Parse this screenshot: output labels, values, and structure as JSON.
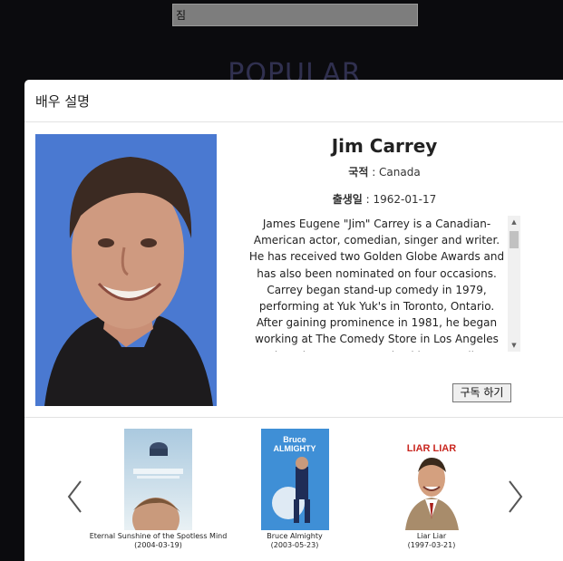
{
  "search": {
    "value": "짐"
  },
  "background": {
    "heading": "POPULAR"
  },
  "modal": {
    "title": "배우 설명",
    "actor": {
      "name": "Jim Carrey",
      "nationality_label": "국적",
      "nationality": "Canada",
      "birthdate_label": "출생일",
      "birthdate": "1962-01-17",
      "bio": "James Eugene \"Jim\" Carrey is a Canadian-American actor, comedian, singer and writer. He has received two Golden Globe Awards and has also been nominated on four occasions. Carrey began stand-up comedy in 1979, performing at Yuk Yuk's in Toronto, Ontario. After gaining prominence in 1981, he began working at The Comedy Store in Los Angeles where he was soon noticed by comedian Rodney Dangerfield, who immediately signed him to open his tour performances."
    },
    "subscribe_label": "구독 하기",
    "movies": [
      {
        "title": "Eternal Sunshine of the Spotless Mind",
        "date": "(2004-03-19)"
      },
      {
        "title": "Bruce Almighty",
        "date": "(2003-05-23)",
        "poster_text_1": "Bruce",
        "poster_text_2": "ALMIGHTY"
      },
      {
        "title": "Liar Liar",
        "date": "(1997-03-21)",
        "poster_text": "LIAR LIAR"
      }
    ]
  },
  "icons": {
    "prev": "chevron-left-icon",
    "next": "chevron-right-icon",
    "scroll_up": "triangle-up-icon",
    "scroll_down": "triangle-down-icon"
  },
  "colors": {
    "page_bg": "#0b0b0e",
    "heading": "#30304f",
    "photo_bg": "#4a79d1"
  }
}
